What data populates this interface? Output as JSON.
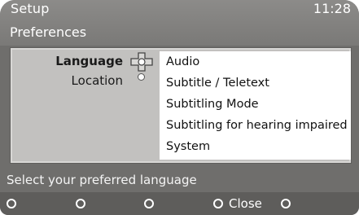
{
  "header": {
    "title": "Setup",
    "clock": "11:28",
    "subtitle": "Preferences"
  },
  "menu": {
    "left_items": [
      {
        "label": "Language",
        "active": true
      },
      {
        "label": "Location",
        "active": false
      }
    ],
    "right_items": [
      {
        "label": "Audio"
      },
      {
        "label": "Subtitle / Teletext"
      },
      {
        "label": "Subtitling Mode"
      },
      {
        "label": "Subtitling for hearing impaired"
      },
      {
        "label": "System"
      }
    ]
  },
  "status": {
    "text": "Select your preferred language"
  },
  "footer": {
    "buttons": [
      {
        "label": ""
      },
      {
        "label": ""
      },
      {
        "label": ""
      },
      {
        "label": "Close"
      },
      {
        "label": ""
      }
    ]
  },
  "icons": {
    "navigation": "navigation-cross-icon",
    "selection": "selection-dot-icon",
    "footer_button": "circle-button-icon"
  },
  "colors": {
    "frame": "#6f6e6c",
    "panel": "#c2c1bf",
    "content": "#ffffff",
    "footer": "#5e5d5b"
  }
}
